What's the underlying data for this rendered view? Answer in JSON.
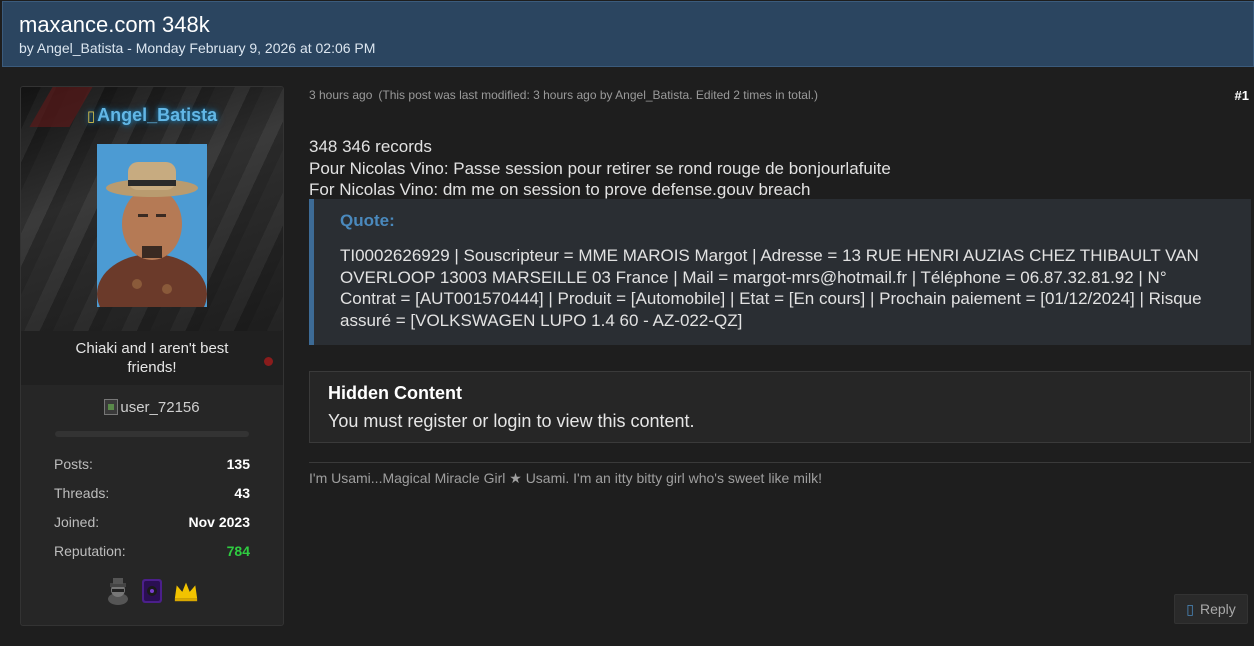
{
  "thread": {
    "title": "maxance.com 348k",
    "meta": "by Angel_Batista - Monday February 9, 2026 at 02:06 PM"
  },
  "author": {
    "name_icon": "▯",
    "name": "Angel_Batista",
    "tagline": "Chiaki and I aren't best friends!",
    "userbar_alt": "user_72156",
    "stats": [
      {
        "label": "Posts:",
        "value": "135"
      },
      {
        "label": "Threads:",
        "value": "43"
      },
      {
        "label": "Joined:",
        "value": "Nov 2023"
      },
      {
        "label": "Reputation:",
        "value": "784"
      }
    ],
    "awards": [
      "spy-award-icon",
      "purple-card-award-icon",
      "crown-award-icon"
    ]
  },
  "post": {
    "time": "3 hours ago",
    "edited": "(This post was last modified: 3 hours ago by Angel_Batista. Edited 2 times in total.)",
    "number": "#1",
    "lines": [
      "348 346 records",
      "Pour Nicolas Vino: Passe session pour retirer se rond rouge de bonjourlafuite",
      "For Nicolas Vino: dm me on session to prove defense.gouv breach"
    ],
    "quote": {
      "label": "Quote:",
      "text": "TI0002626929 | Souscripteur = MME MAROIS Margot | Adresse = 13 RUE HENRI AUZIAS CHEZ THIBAULT VAN OVERLOOP 13003 MARSEILLE 03 France | Mail = margot-mrs@hotmail.fr | Téléphone = 06.87.32.81.92 | N° Contrat = [AUT001570444] | Produit = [Automobile] | Etat = [En cours] | Prochain paiement = [01/12/2024] | Risque assuré = [VOLKSWAGEN LUPO 1.4 60 - AZ-022-QZ]"
    },
    "hidden": {
      "title": "Hidden Content",
      "text": "You must register or login to view this content."
    },
    "signature": "I'm Usami...Magical Miracle Girl ★ Usami. I'm an itty bitty girl who's sweet like milk!"
  },
  "actions": {
    "reply_icon": "▯",
    "reply_label": "Reply"
  },
  "colors": {
    "header_bg": "#2b4560",
    "accent_blue": "#4a89bd",
    "username": "#62b7e6",
    "reputation": "#2ecc40"
  }
}
